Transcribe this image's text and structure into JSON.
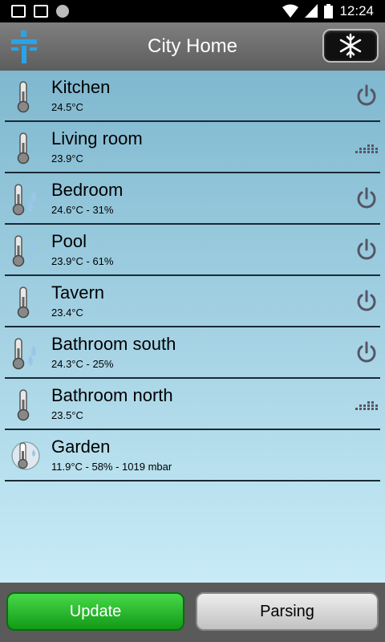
{
  "statusbar": {
    "time": "12:24"
  },
  "header": {
    "title": "City Home",
    "snow_icon": "snowflake-icon"
  },
  "rooms": [
    {
      "name": "Kitchen",
      "detail": "24.5°C",
      "sensor_icon": "thermometer-icon",
      "action_icon": "power-icon"
    },
    {
      "name": "Living room",
      "detail": "23.9°C",
      "sensor_icon": "thermometer-icon",
      "action_icon": "level-bars-icon"
    },
    {
      "name": "Bedroom",
      "detail": "24.6°C - 31%",
      "sensor_icon": "thermometer-humidity-icon",
      "action_icon": "power-icon"
    },
    {
      "name": "Pool",
      "detail": "23.9°C - 61%",
      "sensor_icon": "thermometer-humidity-icon",
      "action_icon": "power-icon"
    },
    {
      "name": "Tavern",
      "detail": "23.4°C",
      "sensor_icon": "thermometer-icon",
      "action_icon": "power-icon"
    },
    {
      "name": "Bathroom south",
      "detail": "24.3°C - 25%",
      "sensor_icon": "thermometer-humidity-icon",
      "action_icon": "power-icon"
    },
    {
      "name": "Bathroom north",
      "detail": "23.5°C",
      "sensor_icon": "thermometer-icon",
      "action_icon": "level-bars-icon"
    },
    {
      "name": "Garden",
      "detail": "11.9°C - 58% - 1019 mbar",
      "sensor_icon": "weather-station-icon",
      "action_icon": ""
    }
  ],
  "footer": {
    "update_label": "Update",
    "parsing_label": "Parsing"
  },
  "colors": {
    "accent_blue": "#2aa4e6",
    "update_green": "#1fb024",
    "list_top": "#7fb8cf",
    "list_bottom": "#c8ebf7"
  }
}
